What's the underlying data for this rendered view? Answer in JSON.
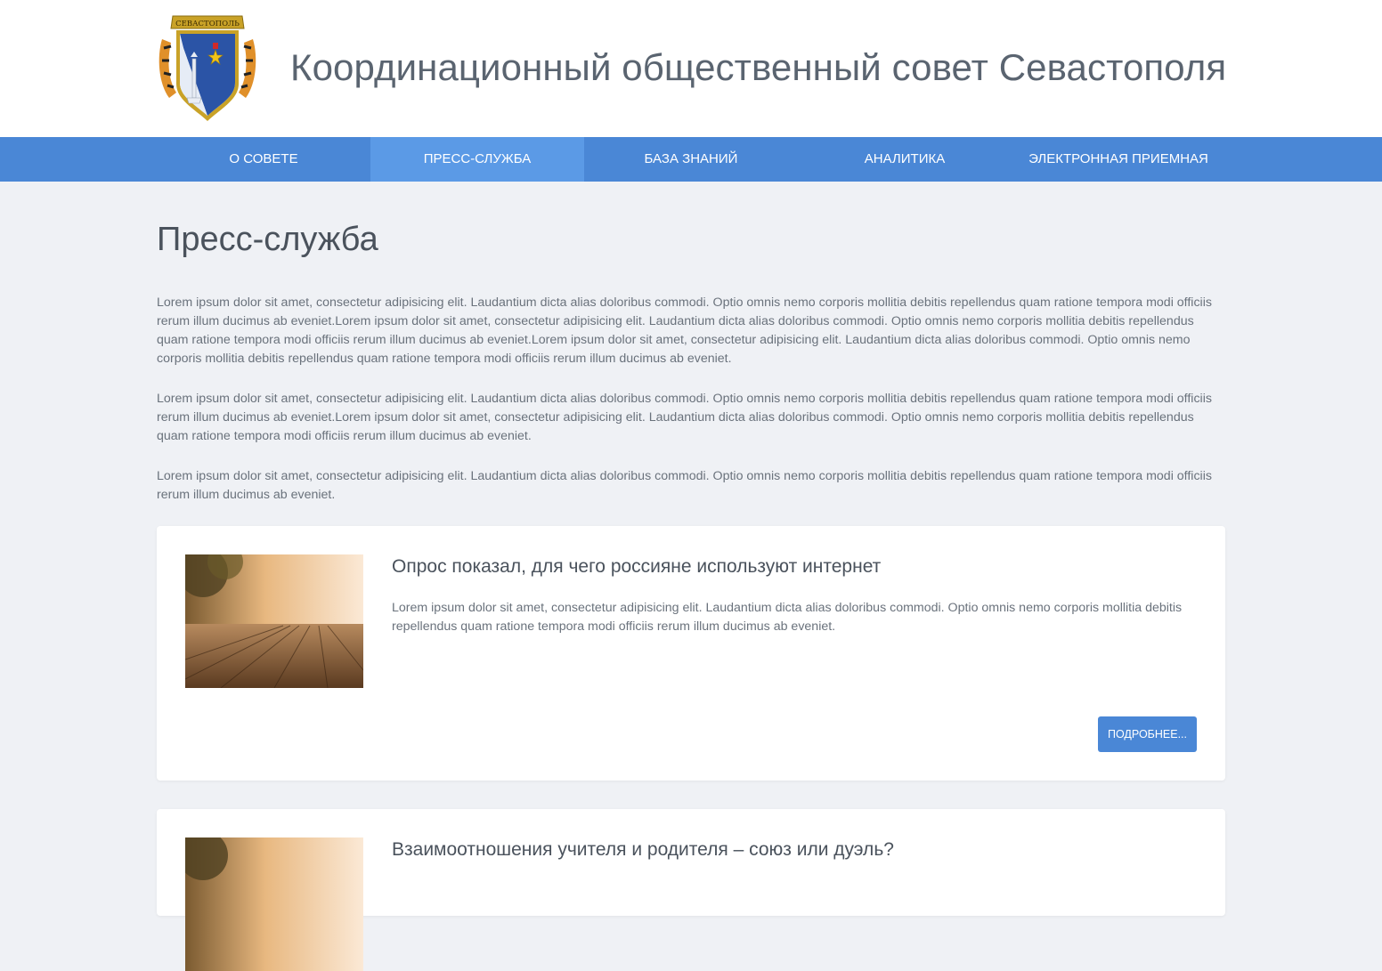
{
  "header": {
    "logo_icon": "sevastopol-coat-of-arms-icon",
    "logo_text": "СЕВАСТОПОЛЬ",
    "title": "Координационный общественный совет Севастополя"
  },
  "nav": {
    "items": [
      {
        "label": "О совете"
      },
      {
        "label": "Пресс-служба",
        "active": true
      },
      {
        "label": "База знаний"
      },
      {
        "label": "Аналитика"
      },
      {
        "label": "Электронная приемная"
      }
    ]
  },
  "main": {
    "title": "Пресс-служба",
    "intro": [
      "Lorem ipsum dolor sit amet, consectetur adipisicing elit. Laudantium dicta alias doloribus commodi. Optio omnis nemo corporis mollitia debitis repellendus quam ratione tempora modi officiis rerum illum ducimus ab eveniet.Lorem ipsum dolor sit amet, consectetur adipisicing elit. Laudantium dicta alias doloribus commodi. Optio omnis nemo corporis mollitia debitis repellendus quam ratione tempora modi officiis rerum illum ducimus ab eveniet.Lorem ipsum dolor sit amet, consectetur adipisicing elit. Laudantium dicta alias doloribus commodi. Optio omnis nemo corporis mollitia debitis repellendus quam ratione tempora modi officiis rerum illum ducimus ab eveniet.",
      "Lorem ipsum dolor sit amet, consectetur adipisicing elit. Laudantium dicta alias doloribus commodi. Optio omnis nemo corporis mollitia debitis repellendus quam ratione tempora modi officiis rerum illum ducimus ab eveniet.Lorem ipsum dolor sit amet, consectetur adipisicing elit. Laudantium dicta alias doloribus commodi. Optio omnis nemo corporis mollitia debitis repellendus quam ratione tempora modi officiis rerum illum ducimus ab eveniet.",
      "Lorem ipsum dolor sit amet, consectetur adipisicing elit. Laudantium dicta alias doloribus commodi. Optio omnis nemo corporis mollitia debitis repellendus quam ratione tempora modi officiis rerum illum ducimus ab eveniet."
    ],
    "news": [
      {
        "title": "Опрос показал, для чего россияне используют интернет",
        "text": "Lorem ipsum dolor sit amet, consectetur adipisicing elit. Laudantium dicta alias doloribus commodi. Optio omnis nemo corporis mollitia debitis repellendus quam ratione tempora modi officiis rerum illum ducimus ab eveniet.",
        "button": "Подробнее..."
      },
      {
        "title": "Взаимоотношения учителя и родителя – союз или дуэль?"
      }
    ]
  },
  "colors": {
    "accent": "#4a87d6",
    "nav_active": "#5b9ae6",
    "page_bg": "#eff1f5"
  }
}
